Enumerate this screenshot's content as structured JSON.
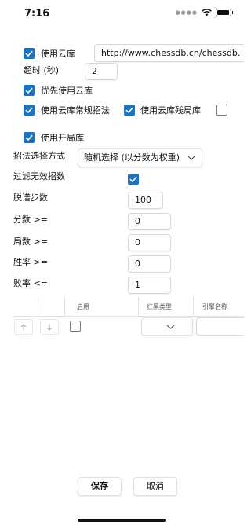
{
  "status_bar": {
    "time": "7:16"
  },
  "cloud": {
    "use_cloud_label": "使用云库",
    "url_value": "http://www.chessdb.cn/chessdb.",
    "timeout_label": "超时 (秒)",
    "timeout_value": "2",
    "prefer_cloud_label": "优先使用云库",
    "cloud_normal_label": "使用云库常规招法",
    "cloud_endgame_label": "使用云库残局库"
  },
  "opening": {
    "use_opening_label": "使用开局库",
    "method_label": "招法选择方式",
    "method_value": "随机选择 (以分数为权重)",
    "filter_invalid_label": "过滤无效招数",
    "exit_steps_label": "脱谱步数",
    "exit_steps_value": "100",
    "score_label": "分数 >=",
    "score_value": "0",
    "games_label": "局数 >=",
    "games_value": "0",
    "winrate_label": "胜率 >=",
    "winrate_value": "0",
    "lossrate_label": "败率 <=",
    "lossrate_value": "1"
  },
  "table": {
    "headers": {
      "enabled": "启用",
      "color_type": "红黑类型",
      "engine_name": "引擎名称"
    },
    "up_icon": "arrow-up-icon",
    "down_icon": "arrow-down-icon"
  },
  "footer": {
    "save_label": "保存",
    "cancel_label": "取消"
  }
}
